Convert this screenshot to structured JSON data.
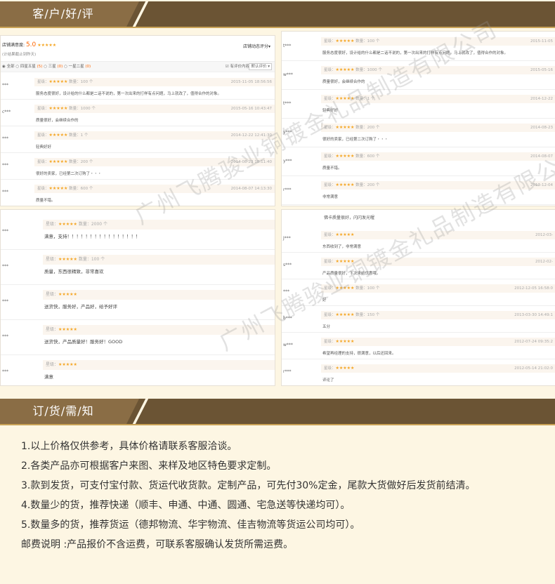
{
  "reviews_section": {
    "title": "客/户/好/评"
  },
  "notice_section": {
    "title": "订/货/需/知"
  },
  "panel1": {
    "score_label": "店铺满意度:",
    "score": "5.0",
    "sort_label": "店铺动态评分",
    "hint": "(计结果截止到昨天)",
    "filters": [
      "全部",
      "四星五星",
      "三星",
      "一星二星"
    ],
    "has_content": "有评价内容",
    "default_sort": "默认评价",
    "reviews": [
      {
        "user": "***",
        "stars": "★★★★★",
        "qty": "数量：100 个",
        "date": "2015-11-05 18:56:56",
        "text": "服务态度很好，设计给的什么都是二话不说的，第一次出来的打样有点问题，马上就改了，值得合作的对象。"
      },
      {
        "user": "c***",
        "stars": "★★★★★",
        "qty": "数量：1000 个",
        "date": "2015-05-16 10:43:47",
        "text": "质量很好，会继续合作的"
      },
      {
        "user": "***",
        "stars": "★★★★★",
        "qty": "数量：1 个",
        "date": "2014-12-22 12:41:30",
        "text": "轻典好好"
      },
      {
        "user": "***",
        "stars": "★★★★★",
        "qty": "数量：200 个",
        "date": "2014-08-23 18:11:40",
        "text": "很好的卖家，已经第二次订购了・・・"
      },
      {
        "user": "***",
        "stars": "★★★★★",
        "qty": "数量：600 个",
        "date": "2014-08-07 14:13:30",
        "text": "质量不错。"
      }
    ]
  },
  "panel2": {
    "reviews": [
      {
        "user": "t***",
        "stars": "★★★★★",
        "qty": "数量：100 个",
        "date": "2015-11-05",
        "text": "服务态度很好，设计给的什么都是二话不说的，第一次出来的打样有点问题，马上就改了，值得合作的对象。"
      },
      {
        "user": "w***",
        "stars": "★★★★★",
        "qty": "数量：1000 个",
        "date": "2015-05-16",
        "text": "质量很好，会继续合作的"
      },
      {
        "user": "t***",
        "stars": "★★★★★",
        "qty": "数量：1 个",
        "date": "2014-12-22",
        "text": "轻典好好"
      },
      {
        "user": "y***",
        "stars": "★★★★★",
        "qty": "数量：200 个",
        "date": "2014-08-23",
        "text": "很好的卖家，已经第二次订购了・・・"
      },
      {
        "user": "y***",
        "stars": "★★★★★",
        "qty": "数量：600 个",
        "date": "2014-08-07",
        "text": "质量不错。"
      },
      {
        "user": "r***",
        "stars": "★★★★★",
        "qty": "数量：200 个",
        "date": "2013-12-04",
        "text": "非常满意"
      }
    ]
  },
  "panel3": {
    "reviews": [
      {
        "user": "***",
        "stars": "★★★★★",
        "qty": "数量：2000 个",
        "text": "满意，支持！！！！！！！！！！！！！！！！"
      },
      {
        "user": "***",
        "stars": "★★★★★",
        "qty": "数量：100 个",
        "text": "质量，东西很精致，非常喜欢"
      },
      {
        "user": "***",
        "stars": "★★★★★",
        "qty": "",
        "text": "送货快，服务好，产品好，给予好评"
      },
      {
        "user": "***",
        "stars": "★★★★★",
        "qty": "",
        "text": "送货快，产品质量好！服务好！GOOD"
      },
      {
        "user": "***",
        "stars": "★★★★★",
        "qty": "",
        "text": "满意"
      }
    ]
  },
  "panel4": {
    "top_text": "佛卡质量很好，闪闪发光喔",
    "reviews": [
      {
        "user": "J***",
        "stars": "★★★★★",
        "qty": "",
        "date": "2012-03-",
        "text": "东西收到了，非常满意"
      },
      {
        "user": "s***",
        "stars": "★★★★★",
        "qty": "",
        "date": "2012-02-",
        "text": "产品质量很好，下次来给优惠哦。"
      },
      {
        "user": "***",
        "stars": "★★★★★",
        "qty": "数量：100 个",
        "date": "2012-12-05 16:58:0",
        "text": "好"
      },
      {
        "user": "b***",
        "stars": "★★★★★",
        "qty": "数量：150 个",
        "date": "2013-03-30 14:49:1",
        "text": "五分"
      },
      {
        "user": "w***",
        "stars": "★★★★★",
        "qty": "",
        "date": "2012-07-24 09:35:2",
        "text": "希望再经理的支持，很满意，以后还回来。"
      },
      {
        "user": "r***",
        "stars": "★★★★★",
        "qty": "",
        "date": "2012-05-14 21:02:0",
        "text": "评论了"
      }
    ]
  },
  "watermark": "广州飞腾骏业铜镀金礼品制造有限公司",
  "notice_lines": [
    "1.以上价格仅供参考，具体价格请联系客服洽谈。",
    "2.各类产品亦可根据客户来图、来样及地区特色要求定制。",
    "3.款到发货，可支付宝付款、货运代收货款。定制产品，可先付30%定金，尾款大货做好后发货前结清。",
    "4.数量少的货，推荐快递（顺丰、申通、中通、圆通、宅急送等快递均可）。",
    "5.数量多的货，推荐货运（德邦物流、华宇物流、佳吉物流等货运公司均可）。",
    "邮费说明 :产品报价不含运费，可联系客服确认发货所需运费。"
  ]
}
